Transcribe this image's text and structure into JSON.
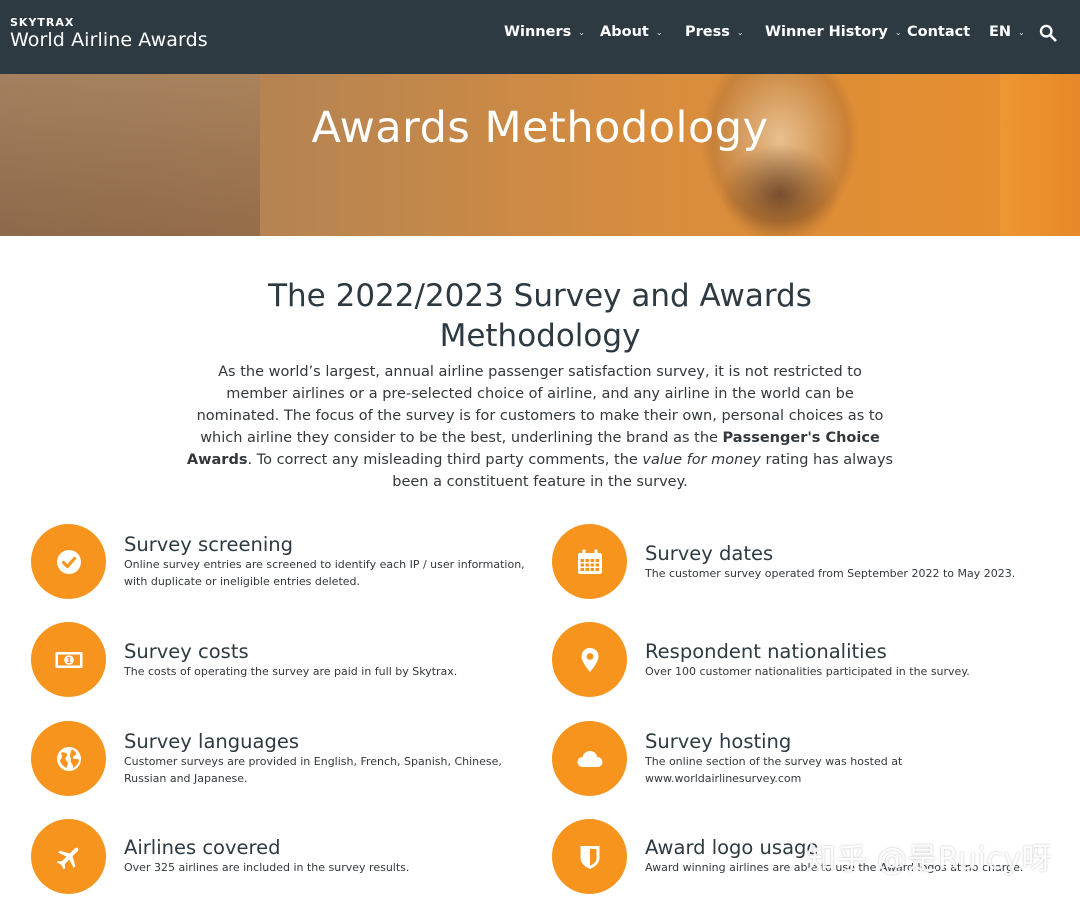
{
  "brand": {
    "top": "SKYTRAX",
    "main": "World Airline Awards"
  },
  "nav": {
    "items": [
      {
        "label": "Winners",
        "dropdown": true
      },
      {
        "label": "About",
        "dropdown": true
      },
      {
        "label": "Press",
        "dropdown": true
      },
      {
        "label": "Winner History",
        "dropdown": true
      },
      {
        "label": "Contact",
        "dropdown": false
      },
      {
        "label": "EN",
        "dropdown": true
      }
    ],
    "search_icon": "search-icon"
  },
  "hero": {
    "title": "Awards Methodology"
  },
  "intro": {
    "title": "The 2022/2023 Survey and Awards Methodology",
    "p1": "As the world’s largest, annual airline passenger satisfaction survey, it is not restricted to member airlines or a pre-selected choice of airline, and any airline in the world can be nominated. The focus of the survey is for customers to make their own, personal choices as to which airline they consider to be the best, underlining the brand as the ",
    "bold": "Passenger's Choice Awards",
    "p2": ". To correct any misleading third party comments, the ",
    "italic": "value for money",
    "p3": " rating has always been a constituent feature in the survey."
  },
  "features": [
    {
      "title": "Survey screening",
      "desc": "Online survey entries are screened to identify each IP / user information, with duplicate or ineligible entries deleted.",
      "icon": "check-circle-icon"
    },
    {
      "title": "Survey dates",
      "desc": "The customer survey operated from September 2022 to May 2023.",
      "icon": "calendar-icon"
    },
    {
      "title": "Survey costs",
      "desc": "The costs of operating the survey are paid in full by Skytrax.",
      "icon": "money-icon"
    },
    {
      "title": "Respondent nationalities",
      "desc": "Over 100 customer nationalities participated in the survey.",
      "icon": "map-pin-icon"
    },
    {
      "title": "Survey languages",
      "desc": "Customer surveys are provided in English, French, Spanish, Chinese, Russian and Japanese.",
      "icon": "globe-icon"
    },
    {
      "title": "Survey hosting",
      "desc": "The online section of the survey was hosted at www.worldairlinesurvey.com",
      "icon": "cloud-icon"
    },
    {
      "title": "Airlines covered",
      "desc": "Over 325 airlines are included in the survey results.",
      "icon": "plane-icon"
    },
    {
      "title": "Award logo usage",
      "desc": "Award winning airlines are able to use the Award logos at no charge.",
      "icon": "shield-icon"
    }
  ],
  "watermark": "知乎 @是Ruicy呀",
  "colors": {
    "nav_bg": "#2d3a42",
    "accent": "#f7941d"
  }
}
